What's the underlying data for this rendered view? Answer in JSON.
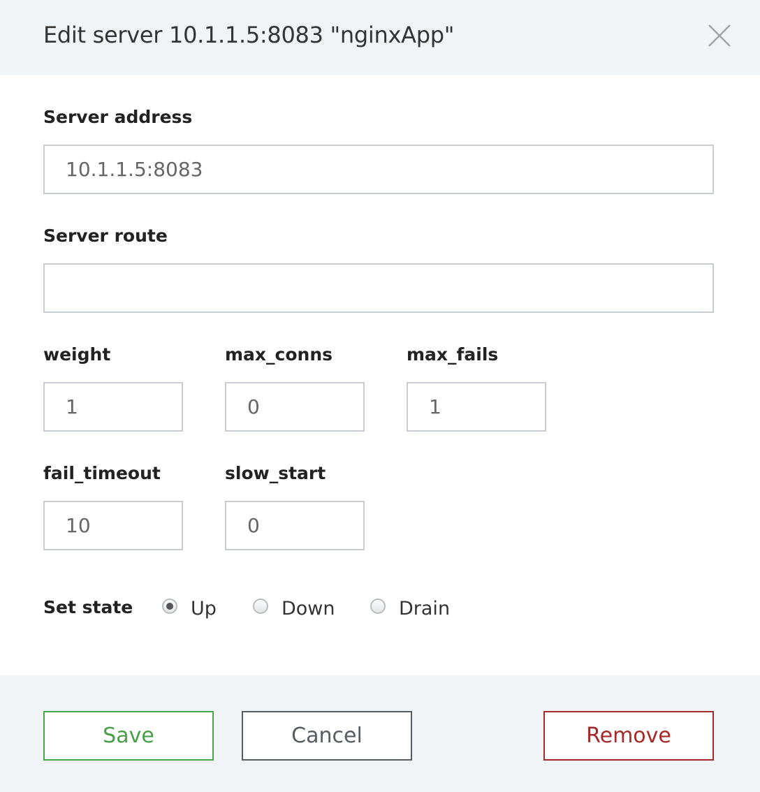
{
  "dialog": {
    "title": "Edit server 10.1.1.5:8083 \"nginxApp\"",
    "close_icon": "close-icon"
  },
  "fields": {
    "server_address": {
      "label": "Server address",
      "value": "10.1.1.5:8083"
    },
    "server_route": {
      "label": "Server route",
      "value": ""
    },
    "weight": {
      "label": "weight",
      "value": "1"
    },
    "max_conns": {
      "label": "max_conns",
      "value": "0"
    },
    "max_fails": {
      "label": "max_fails",
      "value": "1"
    },
    "fail_timeout": {
      "label": "fail_timeout",
      "value": "10"
    },
    "slow_start": {
      "label": "slow_start",
      "value": "0"
    }
  },
  "state": {
    "label": "Set state",
    "options": [
      "Up",
      "Down",
      "Drain"
    ],
    "selected": "Up"
  },
  "buttons": {
    "save": "Save",
    "cancel": "Cancel",
    "remove": "Remove"
  },
  "colors": {
    "header_bg": "#f1f4f7",
    "save": "#4ca44c",
    "cancel": "#555c62",
    "remove": "#a52a2a"
  }
}
